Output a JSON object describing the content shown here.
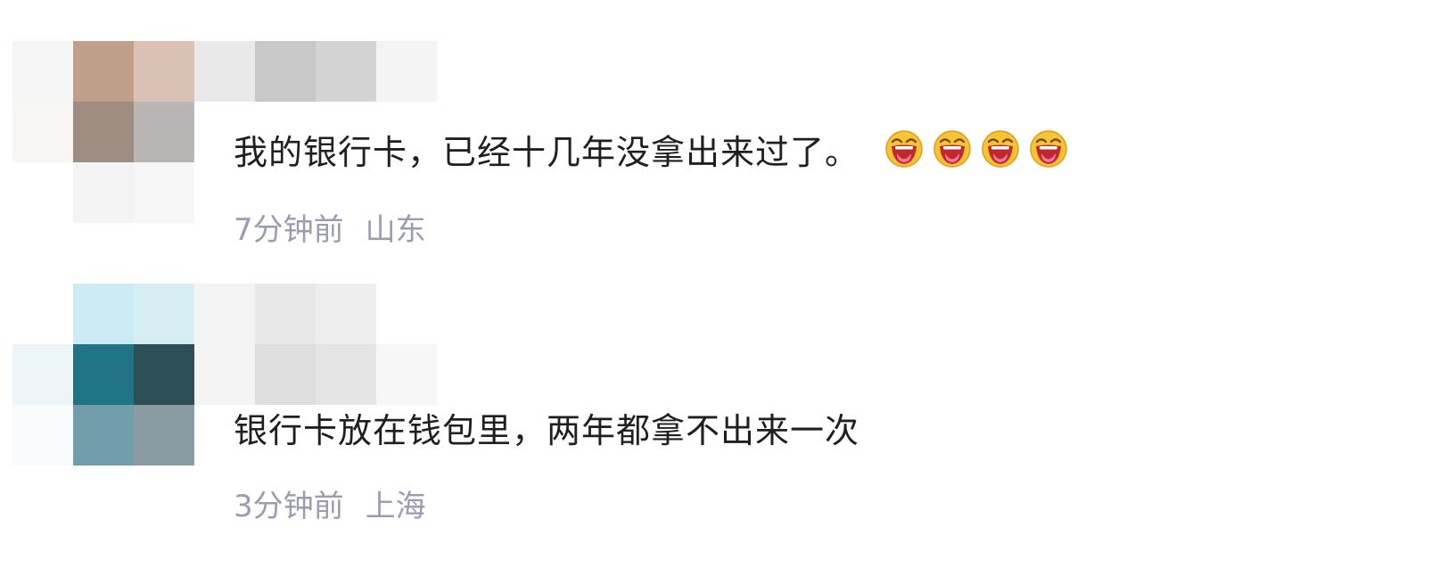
{
  "comments": [
    {
      "text": "我的银行卡，已经十几年没拿出来过了。",
      "emoji_icons": [
        "laughing-crying-face-icon",
        "laughing-crying-face-icon",
        "laughing-crying-face-icon",
        "laughing-crying-face-icon"
      ],
      "time": "7分钟前",
      "location": "山东",
      "avatar_colors": {
        "row1": [
          "#f5f5f5",
          "#bf9f88",
          "#d9c1b3",
          "#e9e9e9",
          "#c8c8c8",
          "#d3d3d3",
          "#f4f4f4"
        ],
        "row2": [
          "#f7f6f3",
          "#9d8d80",
          "#b8b6b4",
          "#ffffff",
          "#ffffff",
          "#ffffff",
          "#ffffff"
        ],
        "row3": [
          "#ffffff",
          "#f3f3f3",
          "#f6f6f6",
          "#ffffff",
          "#ffffff",
          "#ffffff",
          "#ffffff"
        ]
      }
    },
    {
      "text": "银行卡放在钱包里，两年都拿不出来一次",
      "time": "3分钟前",
      "location": "上海",
      "avatar_colors": {
        "row1": [
          "#ffffff",
          "#cdebf2",
          "#d5edf3",
          "#f3f3f3",
          "#e8e8e8",
          "#eeeeee",
          "#ffffff"
        ],
        "row2": [
          "#eef5f8",
          "#217486",
          "#2b4f55",
          "#f4f4f4",
          "#dedede",
          "#e4e4e4",
          "#f7f7f7"
        ],
        "row3": [
          "#f8fbfc",
          "#729eab",
          "#8a9ba1",
          "#ffffff",
          "#ffffff",
          "#ffffff",
          "#ffffff"
        ]
      }
    }
  ]
}
